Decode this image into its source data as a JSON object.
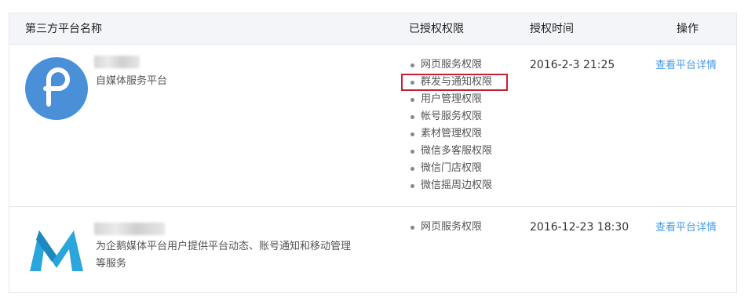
{
  "header": {
    "col_name": "第三方平台名称",
    "col_permissions": "已授权权限",
    "col_time": "授权时间",
    "col_action": "操作"
  },
  "platforms": [
    {
      "description": "自媒体服务平台",
      "permissions": [
        "网页服务权限",
        "群发与通知权限",
        "用户管理权限",
        "帐号服务权限",
        "素材管理权限",
        "微信多客服权限",
        "微信门店权限",
        "微信摇周边权限"
      ],
      "highlighted_permission": "群发与通知权限",
      "time": "2016-2-3 21:25",
      "action": "查看平台详情",
      "logo_color": "#4a90d9",
      "logo_icon": "p-circle-logo-icon"
    },
    {
      "description_line1": "为企鹅媒体平台用户提供平台动态、账号通知和移动管理",
      "description_line2": "等服务",
      "permissions": [
        "网页服务权限"
      ],
      "time": "2016-12-23 18:30",
      "action": "查看平台详情",
      "logo_color": "#2aa6dc",
      "logo_icon": "m-logo-icon"
    }
  ],
  "colors": {
    "header_bg": "#f4f5f9",
    "border": "#e4e8eb",
    "link": "#459ae9",
    "highlight": "#c9202f"
  }
}
